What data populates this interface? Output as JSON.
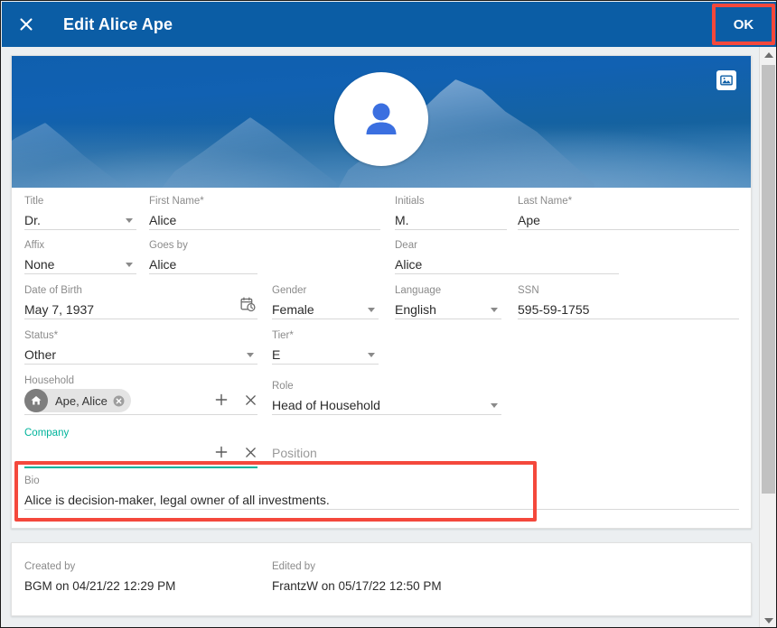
{
  "window": {
    "title": "Edit Alice Ape",
    "close_icon": "close-icon",
    "ok_label": "OK"
  },
  "hero": {
    "avatar_icon": "person-avatar-icon",
    "image_button_icon": "image-picker-icon"
  },
  "form": {
    "fields": [
      {
        "key": "title",
        "label": "Title",
        "value": "Dr.",
        "control": "select"
      },
      {
        "key": "first_name",
        "label": "First Name*",
        "value": "Alice",
        "control": "text"
      },
      {
        "key": "initials",
        "label": "Initials",
        "value": "M.",
        "control": "text"
      },
      {
        "key": "last_name",
        "label": "Last Name*",
        "value": "Ape",
        "control": "text"
      },
      {
        "key": "affix",
        "label": "Affix",
        "value": "None",
        "control": "select"
      },
      {
        "key": "goes_by",
        "label": "Goes by",
        "value": "Alice",
        "control": "text"
      },
      {
        "key": "dear",
        "label": "Dear",
        "value": "Alice",
        "control": "text"
      },
      {
        "key": "date_of_birth",
        "label": "Date of Birth",
        "value": "May 7, 1937",
        "control": "date"
      },
      {
        "key": "gender",
        "label": "Gender",
        "value": "Female",
        "control": "select"
      },
      {
        "key": "language",
        "label": "Language",
        "value": "English",
        "control": "select"
      },
      {
        "key": "ssn",
        "label": "SSN",
        "value": "595-59-1755",
        "control": "text"
      },
      {
        "key": "status",
        "label": "Status*",
        "value": "Other",
        "control": "select"
      },
      {
        "key": "tier",
        "label": "Tier*",
        "value": "E",
        "control": "select"
      },
      {
        "key": "household",
        "label": "Household",
        "value": "Ape, Alice",
        "control": "chip"
      },
      {
        "key": "role",
        "label": "Role",
        "value": "Head of Household",
        "control": "select"
      },
      {
        "key": "company",
        "label": "Company",
        "value": "",
        "control": "chip-empty"
      },
      {
        "key": "position",
        "label": "Position",
        "value": "",
        "control": "text"
      },
      {
        "key": "bio",
        "label": "Bio",
        "value": "Alice is decision-maker, legal owner of all investments.",
        "control": "text"
      }
    ],
    "add_icon": "plus-icon",
    "remove_icon": "close-x-icon",
    "calendar_icon": "calendar-clock-icon",
    "chip_remove_icon": "chip-remove-icon",
    "chip_avatar_icon": "house-icon"
  },
  "footer": {
    "created_label": "Created by",
    "created_value": "BGM on 04/21/22 12:29 PM",
    "edited_label": "Edited by",
    "edited_value": "FrantzW on 05/17/22 12:50 PM"
  },
  "scrollbar": {
    "up_icon": "scroll-up-arrow-icon",
    "down_icon": "scroll-down-arrow-icon"
  },
  "colors": {
    "header_blue": "#0b5da5",
    "accent_teal": "#00b39b",
    "annotation_red": "#f4483c",
    "avatar_blue": "#3b6fe0"
  }
}
